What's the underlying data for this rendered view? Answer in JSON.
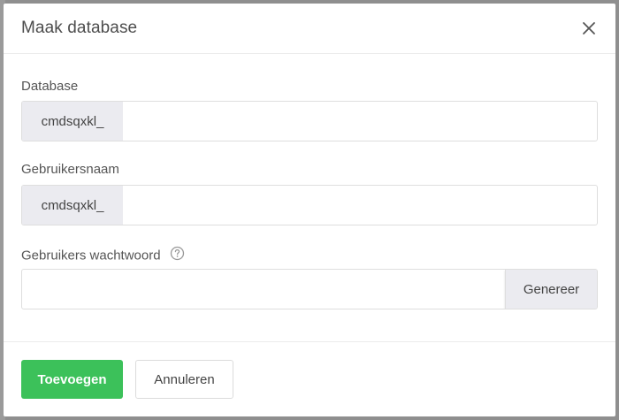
{
  "modal": {
    "title": "Maak database",
    "close_icon": "close-icon"
  },
  "fields": {
    "database": {
      "label": "Database",
      "prefix": "cmdsqxkl_",
      "value": ""
    },
    "username": {
      "label": "Gebruikersnaam",
      "prefix": "cmdsqxkl_",
      "value": ""
    },
    "password": {
      "label": "Gebruikers wachtwoord",
      "help_icon": "question-circle-icon",
      "value": "",
      "generate_label": "Genereer"
    }
  },
  "footer": {
    "add_label": "Toevoegen",
    "cancel_label": "Annuleren"
  },
  "colors": {
    "primary": "#3cc15a",
    "addon_bg": "#ebebf0",
    "backdrop": "#8f8f8f"
  }
}
